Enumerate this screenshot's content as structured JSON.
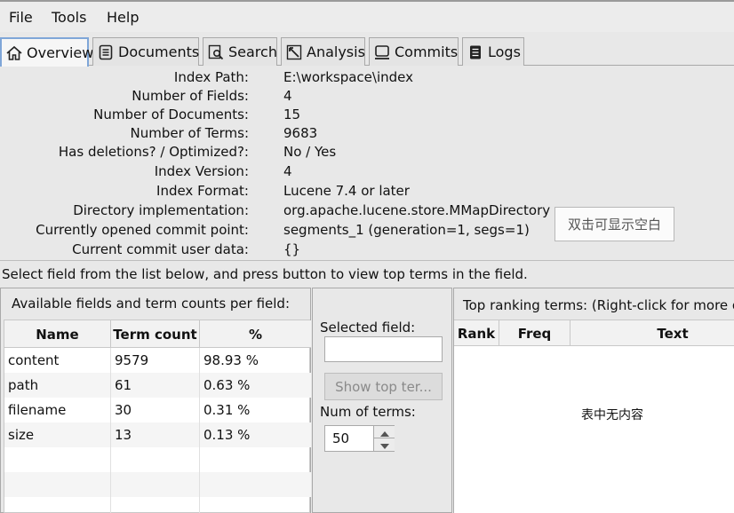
{
  "menu": [
    "File",
    "Tools",
    "Help"
  ],
  "tabs": [
    {
      "label": "Overview",
      "icon": "home-icon",
      "active": true
    },
    {
      "label": "Documents",
      "icon": "document-list-icon",
      "active": false
    },
    {
      "label": "Search",
      "icon": "search-icon",
      "active": false
    },
    {
      "label": "Analysis",
      "icon": "analysis-icon",
      "active": false
    },
    {
      "label": "Commits",
      "icon": "commits-icon",
      "active": false
    },
    {
      "label": "Logs",
      "icon": "logs-icon",
      "active": false
    }
  ],
  "overview": {
    "rows": [
      {
        "label": "Index Path:",
        "value": "E:\\workspace\\index"
      },
      {
        "label": "Number of Fields:",
        "value": "4"
      },
      {
        "label": "Number of Documents:",
        "value": "15"
      },
      {
        "label": "Number of Terms:",
        "value": "9683"
      },
      {
        "label": "Has deletions? / Optimized?:",
        "value": "No / Yes"
      },
      {
        "label": "Index Version:",
        "value": "4"
      },
      {
        "label": "Index Format:",
        "value": "Lucene 7.4 or later"
      },
      {
        "label": "Directory implementation:",
        "value": "org.apache.lucene.store.MMapDirectory"
      },
      {
        "label": "Currently opened commit point:",
        "value": "segments_1 (generation=1, segs=1)"
      },
      {
        "label": "Current commit user data:",
        "value": "{}"
      }
    ],
    "blank_button_label": "双击可显示空白"
  },
  "instruction": "Select field from the list below, and press button to view top terms in the field.",
  "fields_panel": {
    "title": "Available fields and term counts per field:",
    "columns": [
      "Name",
      "Term count",
      "%"
    ],
    "rows": [
      [
        "content",
        "9579",
        "98.93 %"
      ],
      [
        "path",
        "61",
        "0.63 %"
      ],
      [
        "filename",
        "30",
        "0.31 %"
      ],
      [
        "size",
        "13",
        "0.13 %"
      ],
      [
        "",
        "",
        ""
      ],
      [
        "",
        "",
        ""
      ],
      [
        "",
        "",
        ""
      ]
    ]
  },
  "middle_panel": {
    "selected_field_label": "Selected field:",
    "selected_field_value": "",
    "show_button_label": "Show top ter...",
    "num_terms_label": "Num of terms:",
    "num_terms_value": "50"
  },
  "top_terms_panel": {
    "title": "Top ranking terms: (Right-click for more op",
    "columns": [
      "Rank",
      "Freq",
      "Text"
    ],
    "empty_text": "表中无内容"
  }
}
